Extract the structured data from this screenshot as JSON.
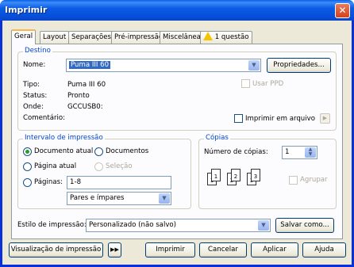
{
  "window": {
    "title": "Imprimir"
  },
  "tabs": [
    {
      "label": "Geral"
    },
    {
      "label": "Layout"
    },
    {
      "label": "Separações"
    },
    {
      "label": "Pré-impressão"
    },
    {
      "label": "Miscelânea"
    },
    {
      "label": "1 questão"
    }
  ],
  "destino": {
    "group_title": "Destino",
    "nome_label": "Nome:",
    "nome_value": "Puma III 60",
    "propriedades_button": "Propriedades...",
    "tipo_label": "Tipo:",
    "tipo_value": "Puma III 60",
    "status_label": "Status:",
    "status_value": "Pronto",
    "onde_label": "Onde:",
    "onde_value": "GCCUSB0:",
    "comentario_label": "Comentário:",
    "usar_ppd": "Usar PPD",
    "imprimir_em_arquivo": "Imprimir em arquivo"
  },
  "intervalo": {
    "group_title": "Intervalo de impressão",
    "documento_atual": "Documento atual",
    "documentos": "Documentos",
    "pagina_atual": "Página atual",
    "selecao": "Seleção",
    "paginas_label": "Páginas:",
    "paginas_value": "1-8",
    "pares_impares": "Pares e ímpares"
  },
  "copias": {
    "group_title": "Cópias",
    "numero_label": "Número de cópias:",
    "numero_value": "1",
    "agrupar": "Agrupar",
    "pages": [
      "1",
      "1",
      "2",
      "2",
      "3",
      "3"
    ]
  },
  "estilo": {
    "label": "Estilo de impressão:",
    "value": "Personalizado (não salvo)",
    "salvar_como": "Salvar como..."
  },
  "footer": {
    "visualizacao": "Visualização de impressão",
    "imprimir": "Imprimir",
    "cancelar": "Cancelar",
    "aplicar": "Aplicar",
    "ajuda": "Ajuda"
  },
  "colors": {
    "accent": "#0046d5",
    "titlebar": "#0a5fe6",
    "selection": "#316ac5"
  }
}
